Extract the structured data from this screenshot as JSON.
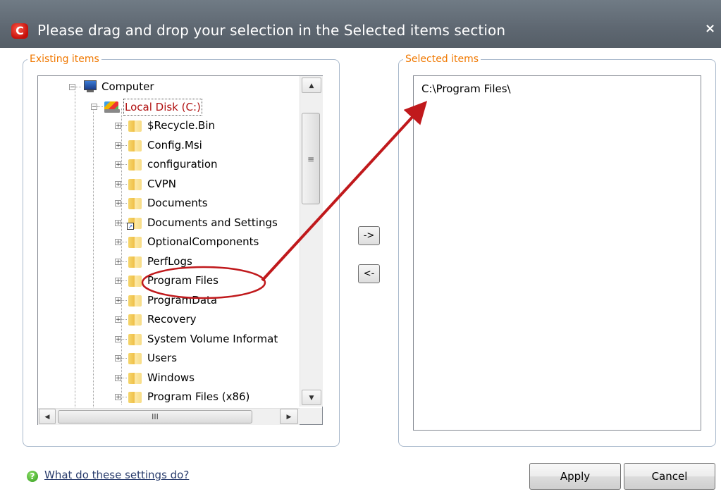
{
  "window": {
    "title": "Please drag and drop your selection in the Selected items section",
    "app_icon_letter": "C",
    "close_glyph": "×"
  },
  "existing": {
    "legend": "Existing items",
    "tree": [
      {
        "label": "Computer",
        "kind": "computer",
        "expander": "minus"
      },
      {
        "label": "Local Disk (C:)",
        "kind": "drive",
        "expander": "minus",
        "selected": true
      },
      {
        "label": "$Recycle.Bin",
        "kind": "folder",
        "expander": "plus"
      },
      {
        "label": "Config.Msi",
        "kind": "folder",
        "expander": "plus"
      },
      {
        "label": "configuration",
        "kind": "folder",
        "expander": "plus"
      },
      {
        "label": "CVPN",
        "kind": "folder",
        "expander": "plus"
      },
      {
        "label": "Documents",
        "kind": "folder",
        "expander": "plus"
      },
      {
        "label": "Documents and Settings",
        "kind": "shortcut",
        "expander": "plus"
      },
      {
        "label": "OptionalComponents",
        "kind": "folder",
        "expander": "plus"
      },
      {
        "label": "PerfLogs",
        "kind": "folder",
        "expander": "plus"
      },
      {
        "label": "Program Files",
        "kind": "folder",
        "expander": "plus",
        "highlighted": true
      },
      {
        "label": "ProgramData",
        "kind": "folder",
        "expander": "plus"
      },
      {
        "label": "Recovery",
        "kind": "folder",
        "expander": "plus"
      },
      {
        "label": "System Volume Informat",
        "kind": "folder",
        "expander": "plus"
      },
      {
        "label": "Users",
        "kind": "folder",
        "expander": "plus"
      },
      {
        "label": "Windows",
        "kind": "folder",
        "expander": "plus"
      },
      {
        "label": "Program Files (x86)",
        "kind": "folder",
        "expander": "plus"
      }
    ],
    "hscroll_grip": "III",
    "vscroll_grip": "≡"
  },
  "selected": {
    "legend": "Selected items",
    "items": [
      "C:\\Program Files\\"
    ]
  },
  "move": {
    "add_label": "->",
    "remove_label": "<-"
  },
  "footer": {
    "help_link": "What do these settings do?",
    "apply_label": "Apply",
    "cancel_label": "Cancel"
  },
  "colors": {
    "titlebar": "#5e6771",
    "legend_text": "#f07800",
    "selected_tree_text": "#b01010",
    "annotation_red": "#c0191c",
    "group_border": "#a9b9cc"
  }
}
